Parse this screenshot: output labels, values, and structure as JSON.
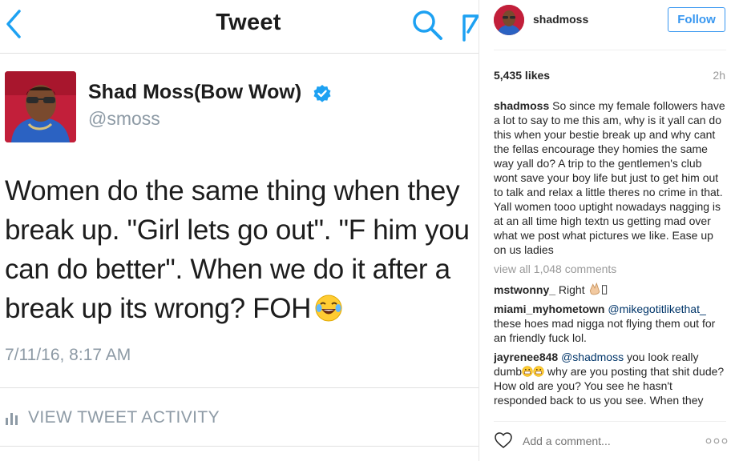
{
  "tweet_view": {
    "header_title": "Tweet",
    "author_name": "Shad Moss(Bow Wow)",
    "author_handle": "@smoss",
    "text": "Women do the same thing when they break up. \"Girl lets go out\". \"F him you can do better\". When we do it after a break up its wrong? FOH",
    "timestamp": "7/11/16, 8:17 AM",
    "activity_label": "VIEW TWEET ACTIVITY",
    "icons": [
      "back-chevron-icon",
      "search-icon",
      "compose-icon",
      "verified-badge-icon",
      "joy-emoji-icon",
      "bar-chart-icon"
    ],
    "colors": {
      "accent": "#1da1f2",
      "muted": "#8d9aa5"
    }
  },
  "instagram_post": {
    "username": "shadmoss",
    "follow_label": "Follow",
    "likes": "5,435 likes",
    "time_ago": "2h",
    "caption": {
      "username": "shadmoss",
      "text": "So since my female followers have a lot to say to me this am, why is it yall can do this when your bestie break up and why cant the fellas encourage they homies the same way yall do? A trip to the gentlemen's club wont save your boy life but just to get him out to talk and relax a little theres no crime in that. Yall women tooo uptight nowadays nagging is at an all time high textn us getting mad over what we post what pictures we like. Ease up on us ladies"
    },
    "view_all_label": "view all 1,048 comments",
    "comments": [
      {
        "username": "mstwonny_",
        "text": "Right"
      },
      {
        "username": "miami_myhometown",
        "mention": "@mikegotitlikethat_",
        "text": "these hoes mad nigga not flying them out for an friendly fuck lol."
      },
      {
        "username": "jayrenee848",
        "mention": "@shadmoss",
        "text_before": "you look really dumb",
        "text_after": "why are you posting that shit dude? How old are you? You see he hasn't responded back to us you see. When they"
      }
    ],
    "add_comment_placeholder": "Add a comment...",
    "icons": [
      "heart-icon",
      "more-options-icon",
      "clap-emoji-icon",
      "grin-emoji-icon"
    ],
    "colors": {
      "link": "#3897f0",
      "muted": "#999999"
    }
  }
}
